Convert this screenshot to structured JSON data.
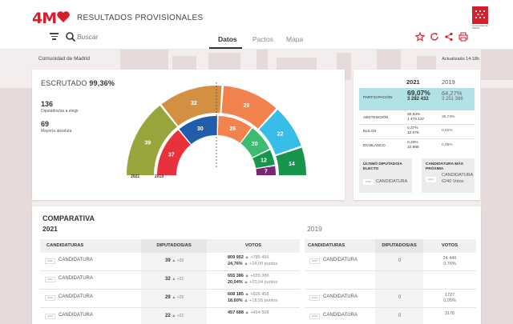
{
  "header": {
    "logo": "4M",
    "title": "RESULTADOS PROVISIONALES",
    "region_logo_text": "Comunidad de Madrid",
    "search": {
      "placeholder": "Buscar"
    },
    "tabs": [
      {
        "label": "Datos"
      },
      {
        "label": "Pactos"
      },
      {
        "label": "Mapa"
      }
    ],
    "actions": [
      "star-icon",
      "refresh-icon",
      "share-icon",
      "print-icon"
    ],
    "accent_color": "#d4202a"
  },
  "location_bar": {
    "region": "Comunidad de Madrid",
    "updated": "Actualizado 14:18h"
  },
  "summary": {
    "escrutado_label": "ESCRUTADO",
    "escrutado_value": "99,36%",
    "seats_total": "136",
    "seats_total_label": "Diputados/as a elegir",
    "majority": "69",
    "majority_label": "Mayoría absoluta",
    "year_outer": "2021",
    "year_inner": "2019"
  },
  "chart_data": {
    "type": "pie",
    "subtype": "parliament-hemicycle",
    "series": [
      {
        "name": "2021",
        "categories": [
          "1",
          "2",
          "3",
          "4",
          "5"
        ],
        "values": [
          39,
          32,
          29,
          22,
          14
        ],
        "colors": [
          "#9aa43c",
          "#d49042",
          "#f3834e",
          "#37bde7",
          "#17954c"
        ]
      },
      {
        "name": "2019",
        "categories": [
          "1",
          "2",
          "3",
          "4",
          "5",
          "6"
        ],
        "values": [
          37,
          30,
          26,
          20,
          12,
          7
        ],
        "colors": [
          "#e8313b",
          "#205eac",
          "#f3834e",
          "#3cbc73",
          "#17954c",
          "#7a2570"
        ]
      }
    ],
    "center_line": true
  },
  "participation": {
    "year_2021": "2021",
    "year_2019": "2019",
    "rows": [
      {
        "label": "PARTICIPACIÓN",
        "pct_2021": "69,07%",
        "num_2021": "3 282 432",
        "pct_2019": "64,27%",
        "num_2019": "3 251 386",
        "highlight": "#b0e2e6"
      },
      {
        "label": "ABSTENCIÓN",
        "pct_2021": "30,93%",
        "num_2021": "1 470 137",
        "pct_2019": "35,73%"
      },
      {
        "label": "NULOS",
        "pct_2021": "0,37%",
        "num_2021": "12 075",
        "pct_2019": "0,42%"
      },
      {
        "label": "EN BLANCO",
        "pct_2021": "0,33%",
        "num_2021": "10 868",
        "pct_2019": "0,46%"
      }
    ],
    "ultimo": {
      "title": "ÚLTIMO DIPUTADO/A ELECTO",
      "logo": "LOGO",
      "name": "CANDIDATURA"
    },
    "proxima": {
      "title": "CANDIDATURA MÁS PRÓXIMA",
      "logo": "LOGO",
      "name": "CANDIDATURA",
      "votes": "6240 Votos"
    }
  },
  "comparativa": {
    "title": "COMPARATIVA",
    "year_2021": "2021",
    "year_2019": "2019",
    "headers_2021": [
      "CANDIDATURAS",
      "DIPUTADOS/AS",
      "VOTOS"
    ],
    "headers_2019": [
      "CANDIDATURAS",
      "DIPUTADOS/AS",
      "VOTOS"
    ],
    "rows_2021": [
      {
        "logo": "LOGO",
        "name": "CANDIDATURA",
        "seats": "39",
        "seats_change": "+39",
        "votes": "809 902",
        "votes_change": "+785 456",
        "pct": "24,76%",
        "pct_change": "+24,00 puntos"
      },
      {
        "logo": "LOGO",
        "name": "CANDIDATURA",
        "seats": "32",
        "seats_change": "+32",
        "votes": "655 386",
        "votes_change": "+655 386",
        "pct": "20,04%",
        "pct_change": "+20,04 puntos"
      },
      {
        "logo": "LOGO",
        "name": "CANDIDATURA",
        "seats": "29",
        "seats_change": "+29",
        "votes": "608 185",
        "votes_change": "+606 458",
        "pct": "18,60%",
        "pct_change": "+18,55 puntos"
      },
      {
        "logo": "LOGO",
        "name": "CANDIDATURA",
        "seats": "22",
        "seats_change": "+22",
        "votes": "457 688",
        "votes_change": "+454 508",
        "pct": "",
        "pct_change": ""
      }
    ],
    "rows_2019": [
      {
        "logo": "LOGO",
        "name": "CANDIDATURA",
        "seats": "0",
        "votes": "24 446",
        "pct": "0,76%"
      },
      {
        "logo": "",
        "name": "",
        "seats": "",
        "votes": "",
        "pct": ""
      },
      {
        "logo": "LOGO",
        "name": "CANDIDATURA",
        "seats": "0",
        "votes": "1727",
        "pct": "0,05%"
      },
      {
        "logo": "LOGO",
        "name": "CANDIDATURA",
        "seats": "0",
        "votes": "3178",
        "pct": ""
      }
    ]
  }
}
